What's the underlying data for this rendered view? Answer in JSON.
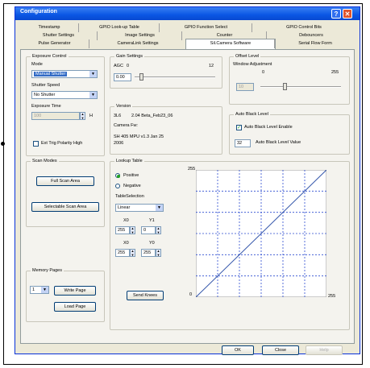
{
  "window": {
    "title": "Configuration",
    "help_glyph": "?",
    "close_glyph": "✕"
  },
  "tabs": {
    "row1": [
      "Timestamp",
      "GPIO Look-up Table",
      "GPIO Function Select",
      "GPIO Control Bits"
    ],
    "row2": [
      "Shutter Settings",
      "Image Settings",
      "Counter",
      "Debouncers"
    ],
    "row3": [
      "Pulse Generator",
      "CameraLink Settings",
      "Sil.Camera Software",
      "Serial Flow Form"
    ],
    "active": "Sil.Camera Software"
  },
  "exposure": {
    "legend": "Exposure Control",
    "mode_label": "Mode",
    "mode_value": "Manual Shutter",
    "shutter_speed_label": "Shutter Speed",
    "shutter_speed_value": "No Shutter",
    "exposure_time_label": "Exposure Time",
    "exposure_time_value": "100",
    "exposure_time_unit": "H",
    "ext_trig_label": "Ext Trig Polarity High"
  },
  "gain": {
    "legend": "Gain Settings",
    "adc_label": "AGC",
    "min": "0",
    "max": "12",
    "value": "0.00"
  },
  "offset": {
    "legend": "Offset Level",
    "label": "Window Adjustment",
    "min": "0",
    "max": "255",
    "value": "10"
  },
  "version": {
    "legend": "Version",
    "line1_a": "3L6",
    "line1_b": "2.04 Beta_Feb23_06",
    "line2": "Camera Fw:",
    "line3": "SH 405 MPU v1.3   Jan 25",
    "line4": "2006"
  },
  "auto_black": {
    "legend": "Auto Black Level",
    "enable_label": "Auto Black Level Enable",
    "value": "32",
    "value_label": "Auto Black Level Value"
  },
  "scan": {
    "legend": "Scan Modes",
    "full_btn": "Full Scan Area",
    "select_btn": "Selectable Scan Area"
  },
  "lookup": {
    "legend": "Lookup Table",
    "top_value": "255",
    "positive_label": "Positive",
    "negative_label": "Negative",
    "table_selection_label": "TableSelection",
    "table_selection_value": "Linear",
    "x0_label": "X0",
    "y1_label": "Y1",
    "x0_value": "255",
    "y1_value": "0",
    "x1_label": "X0",
    "y0_label": "Y0",
    "x1_value": "255",
    "y0_value": "255",
    "send_btn": "Send Knees",
    "axis_zero": "0",
    "axis_max": "255"
  },
  "memory": {
    "legend": "Memory Pages",
    "page_value": "1",
    "write_btn": "Write Page",
    "load_btn": "Load Page"
  },
  "footer": {
    "ok": "OK",
    "close": "Close",
    "help": "Help"
  },
  "colors": {
    "title_bar": "#0a56e4",
    "panel": "#ece9d8",
    "curve_line": "#3355aa",
    "grid_line": "#2b4bd0"
  }
}
